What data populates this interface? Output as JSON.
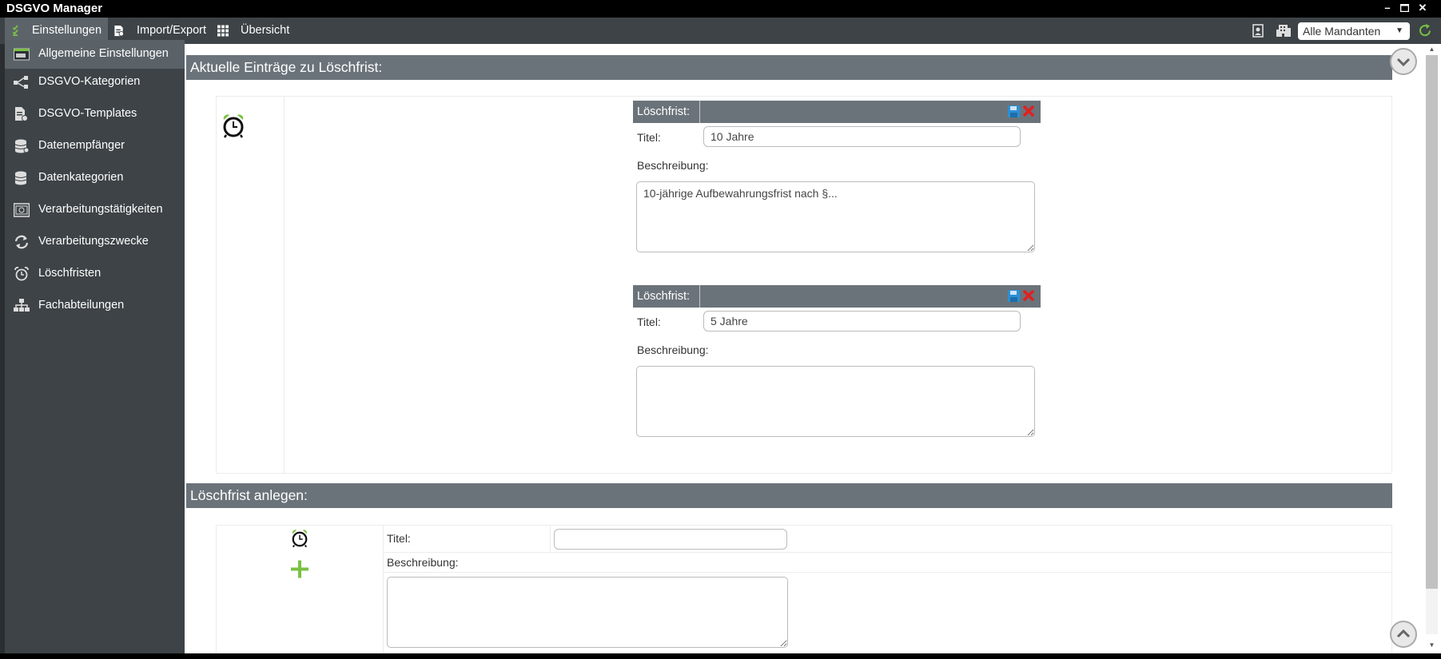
{
  "window": {
    "title": "DSGVO Manager",
    "controls": [
      "minimize-icon",
      "maximize-icon",
      "close-icon"
    ]
  },
  "menubar": {
    "items": [
      {
        "label": "Einstellungen",
        "icon": "checklist-icon",
        "active": true
      },
      {
        "label": "Import/Export",
        "icon": "document-icon",
        "active": false
      },
      {
        "label": "Übersicht",
        "icon": "grid-icon",
        "active": false
      }
    ],
    "right_icons": [
      "contact-card-icon",
      "building-icon",
      "refresh-icon"
    ],
    "mandant_select": {
      "value": "Alle Mandanten"
    }
  },
  "sidebar": {
    "items": [
      {
        "label": "Allgemeine Einstellungen",
        "icon": "settings-window-icon",
        "active": true
      },
      {
        "label": "DSGVO-Kategorien",
        "icon": "share-nodes-icon",
        "active": false
      },
      {
        "label": "DSGVO-Templates",
        "icon": "template-doc-icon",
        "active": false
      },
      {
        "label": "Datenempfänger",
        "icon": "database-icon",
        "active": false
      },
      {
        "label": "Datenkategorien",
        "icon": "data-stack-icon",
        "active": false
      },
      {
        "label": "Verarbeitungstätigkeiten",
        "icon": "safe-icon",
        "active": false
      },
      {
        "label": "Verarbeitungszwecke",
        "icon": "cycle-arrows-icon",
        "active": false
      },
      {
        "label": "Löschfristen",
        "icon": "alarm-clock-icon",
        "active": false
      },
      {
        "label": "Fachabteilungen",
        "icon": "org-chart-icon",
        "active": false
      }
    ]
  },
  "current_section": {
    "heading": "Aktuelle Einträge zu Löschfrist:",
    "entries": [
      {
        "header_label": "Löschfrist:",
        "title_label": "Titel:",
        "title_value": "10 Jahre",
        "description_label": "Beschreibung:",
        "description_value": "10-jährige Aufbewahrungsfrist nach §..."
      },
      {
        "header_label": "Löschfrist:",
        "title_label": "Titel:",
        "title_value": "5 Jahre",
        "description_label": "Beschreibung:",
        "description_value": ""
      }
    ]
  },
  "create_section": {
    "heading": "Löschfrist anlegen:",
    "title_label": "Titel:",
    "title_value": "",
    "description_label": "Beschreibung:",
    "description_value": ""
  },
  "colors": {
    "sidebar_bg": "#3d4347",
    "section_header_bg": "#6b737a",
    "accent_green": "#7ac143",
    "save_blue": "#2b8fd6",
    "delete_red": "#e02020"
  }
}
